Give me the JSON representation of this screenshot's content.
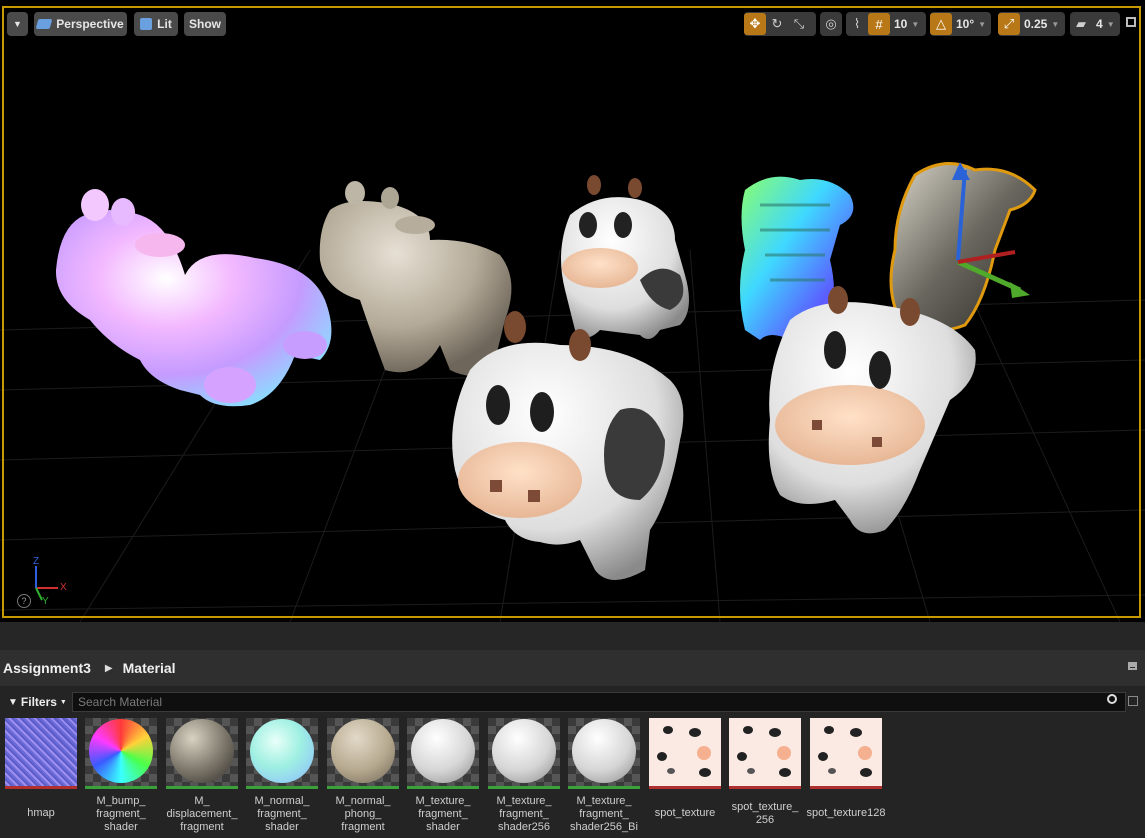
{
  "viewport": {
    "left_toolbar": {
      "menu_label": "",
      "perspective_label": "Perspective",
      "lit_label": "Lit",
      "show_label": "Show"
    },
    "right_toolbar": {
      "grid_snap_value": "10",
      "rotation_snap_value": "10°",
      "scale_snap_value": "0.25",
      "camera_speed_value": "4"
    },
    "axis_labels": {
      "x": "X",
      "z": "Z",
      "y": "Y"
    },
    "help_icon": "?",
    "accent_color": "#c79a00"
  },
  "content_browser": {
    "breadcrumb": [
      "Assignment3",
      "Material"
    ],
    "filters_label": "Filters",
    "search_placeholder": "Search Material",
    "assets": [
      {
        "label": "hmap",
        "bar_color": "#b03030",
        "kind": "texture-noise"
      },
      {
        "label": "M_bump_\nfragment_\nshader",
        "bar_color": "#3aa03a",
        "kind": "sphere-rainbow"
      },
      {
        "label": "M_\ndisplacement_\nfragment",
        "bar_color": "#3aa03a",
        "kind": "sphere-rock"
      },
      {
        "label": "M_normal_\nfragment_\nshader",
        "bar_color": "#3aa03a",
        "kind": "sphere-pastel"
      },
      {
        "label": "M_normal_\nphong_\nfragment",
        "bar_color": "#3aa03a",
        "kind": "sphere-tan"
      },
      {
        "label": "M_texture_\nfragment_\nshader",
        "bar_color": "#3aa03a",
        "kind": "sphere-cow"
      },
      {
        "label": "M_texture_\nfragment_\nshader256",
        "bar_color": "#3aa03a",
        "kind": "sphere-cow"
      },
      {
        "label": "M_texture_\nfragment_\nshader256_Bi",
        "bar_color": "#3aa03a",
        "kind": "sphere-cow"
      },
      {
        "label": "spot_texture",
        "bar_color": "#b03030",
        "kind": "texture-spot"
      },
      {
        "label": "spot_texture_\n256",
        "bar_color": "#b03030",
        "kind": "texture-spot"
      },
      {
        "label": "spot_texture128",
        "bar_color": "#b03030",
        "kind": "texture-spot"
      }
    ]
  }
}
